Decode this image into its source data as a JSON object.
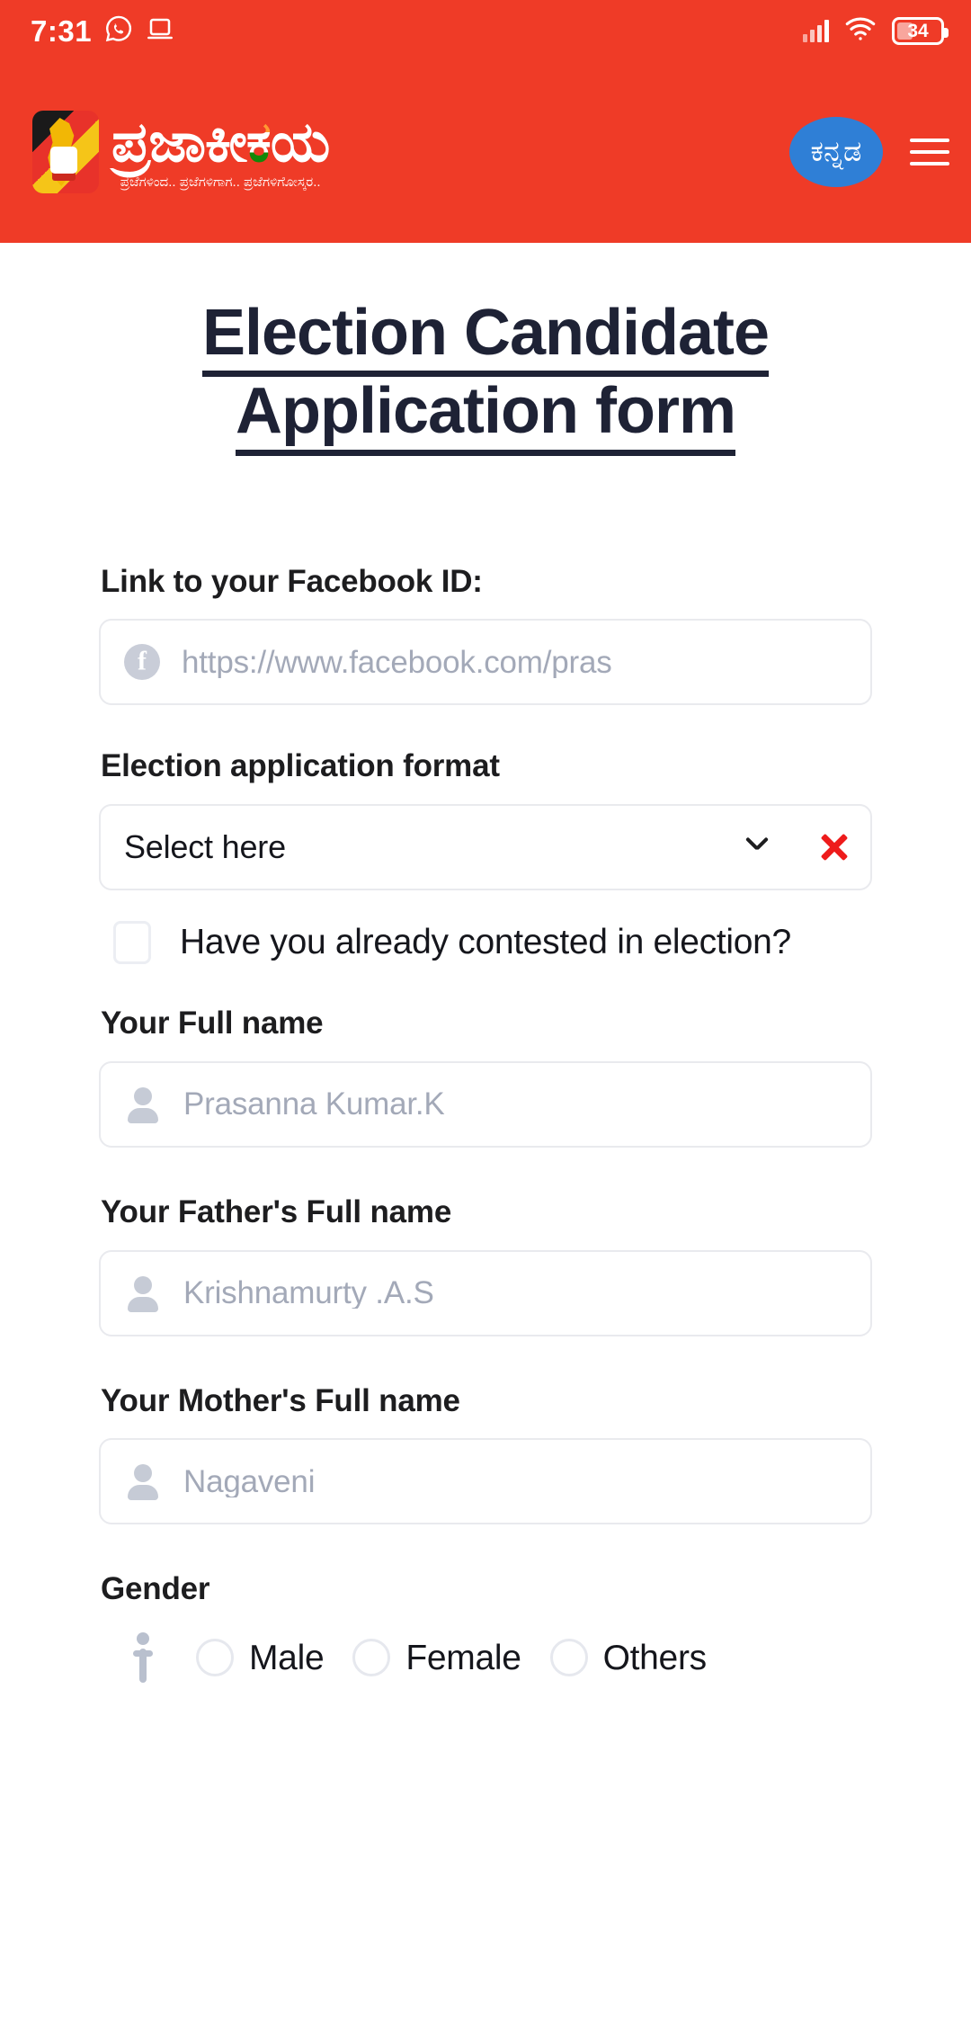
{
  "status_bar": {
    "time": "7:31",
    "whatsapp_icon": "whatsapp-icon",
    "cast_icon": "laptop-icon",
    "signal_icon": "signal-bars-icon",
    "wifi_icon": "wifi-icon",
    "battery_level": "34"
  },
  "header": {
    "logo_alt": "prajakeeya-logo",
    "brand_name_part1": "ಪ್ರಜಾಕೀ",
    "brand_name_flag_char": "ಕ",
    "brand_name_part2": "ಯ",
    "brand_title": "ಪ್ರಜಾಕೀಯ",
    "tagline": "ಪ್ರಜೆಗಳಿಂದ.. ಪ್ರಜೆಗಳಿಗಾಗ.. ಪ್ರಜೆಗಳಿಗೋಸ್ಕರ..",
    "language_button": "ಕನ್ನಡ",
    "menu_icon": "hamburger-menu-icon",
    "background_color": "#ef3b27",
    "language_button_color": "#2f7fd6"
  },
  "page": {
    "title_line1": "Election Candidate",
    "title_line2": "Application form",
    "title_color": "#1e2235"
  },
  "form": {
    "facebook": {
      "label": "Link to your Facebook ID:",
      "icon": "facebook-icon",
      "placeholder": "https://www.facebook.com/pras"
    },
    "election_format": {
      "label": "Election application format",
      "value": "Select here",
      "chevron_icon": "chevron-down-icon",
      "clear_icon": "close-x-icon",
      "clear_icon_color": "#ee1b1b"
    },
    "contested_checkbox": {
      "label": "Have you already contested in election?",
      "checked": false
    },
    "full_name": {
      "label": "Your Full name",
      "icon": "person-icon",
      "placeholder": "Prasanna Kumar.K"
    },
    "father_name": {
      "label": "Your Father's Full name",
      "icon": "person-icon",
      "placeholder": "Krishnamurty .A.S"
    },
    "mother_name": {
      "label": "Your Mother's Full name",
      "icon": "person-icon",
      "placeholder": "Nagaveni"
    },
    "gender": {
      "label": "Gender",
      "icon": "person-standing-icon",
      "options": [
        {
          "label": "Male",
          "selected": false
        },
        {
          "label": "Female",
          "selected": false
        },
        {
          "label": "Others",
          "selected": false
        }
      ]
    }
  }
}
